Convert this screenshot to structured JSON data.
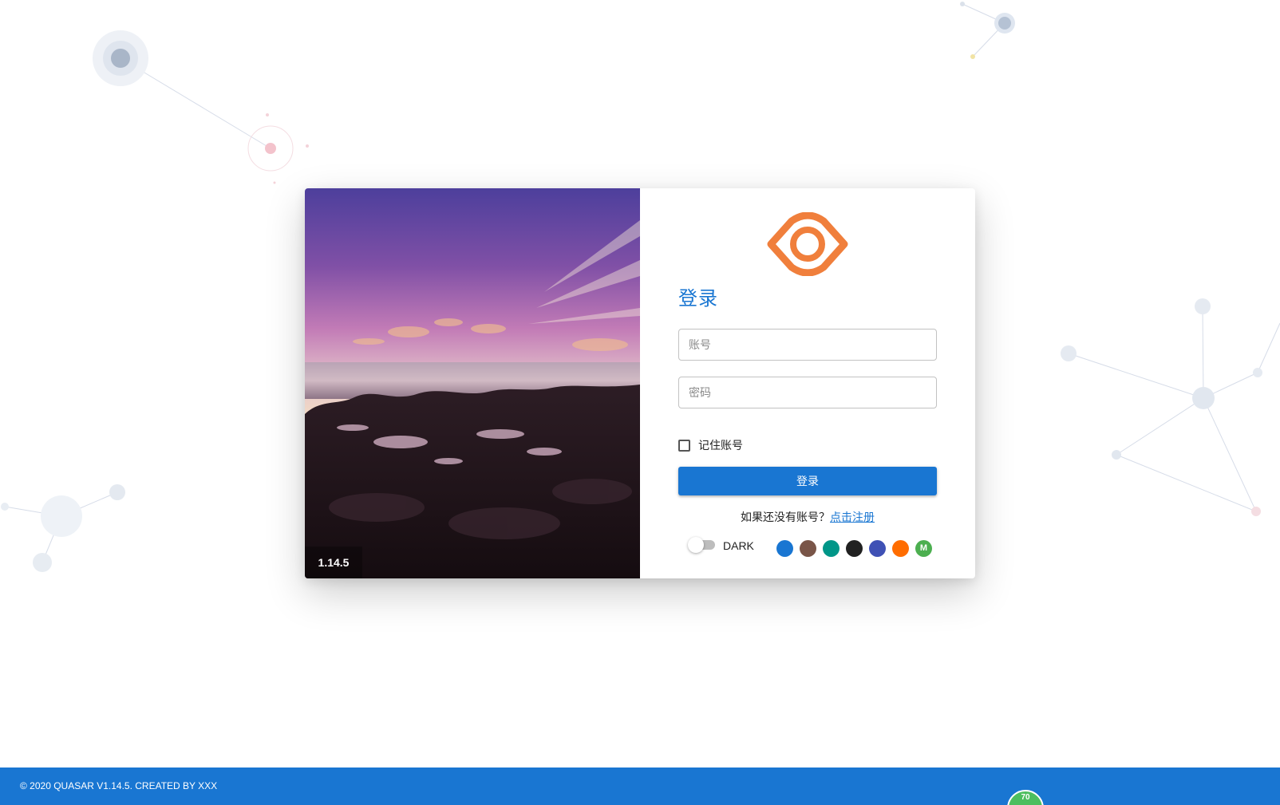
{
  "version": "1.14.5",
  "login": {
    "title": "登录",
    "username_placeholder": "账号",
    "password_placeholder": "密码",
    "remember_label": "记住账号",
    "submit_label": "登录",
    "register_prompt": "如果还没有账号？",
    "register_link": "点击注册"
  },
  "theme": {
    "dark_label": "DARK",
    "dark_enabled": false,
    "swatches": [
      {
        "color": "#1976d2",
        "label": ""
      },
      {
        "color": "#795548",
        "label": ""
      },
      {
        "color": "#009688",
        "label": ""
      },
      {
        "color": "#212121",
        "label": ""
      },
      {
        "color": "#3f51b5",
        "label": ""
      },
      {
        "color": "#ff6d00",
        "label": ""
      },
      {
        "color": "#4caf50",
        "label": "M"
      }
    ]
  },
  "footer": {
    "text": "© 2020 QUASAR V1.14.5.   CREATED BY XXX"
  },
  "fps_badge": "70",
  "colors": {
    "primary": "#1976d2",
    "logo": "#f07f3c",
    "fps_badge": "#4cbe5f"
  }
}
